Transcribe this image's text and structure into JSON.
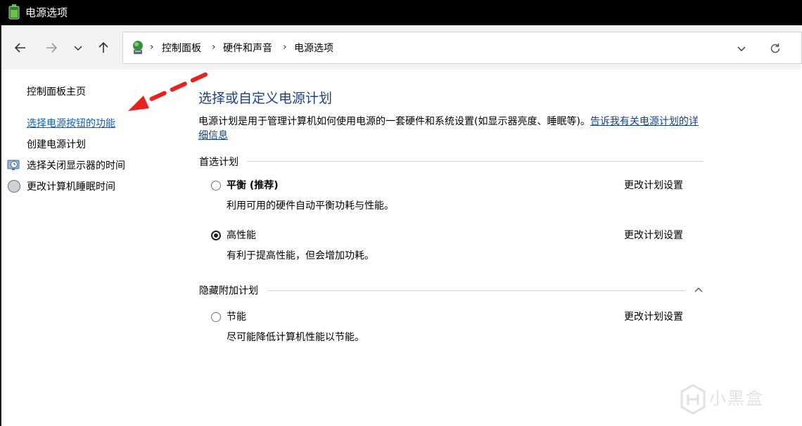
{
  "window": {
    "title": "电源选项"
  },
  "breadcrumb": {
    "items": [
      "控制面板",
      "硬件和声音",
      "电源选项"
    ]
  },
  "sidebar": {
    "home": "控制面板主页",
    "links": [
      {
        "label": "选择电源按钮的功能",
        "highlighted": true
      },
      {
        "label": "创建电源计划",
        "highlighted": false
      },
      {
        "label": "选择关闭显示器的时间",
        "icon": "monitor-clock-icon"
      },
      {
        "label": "更改计算机睡眠时间",
        "icon": "moon-icon"
      }
    ]
  },
  "main": {
    "title": "选择或自定义电源计划",
    "description": "电源计划是用于管理计算机如何使用电源的一套硬件和系统设置(如显示器亮度、睡眠等)。",
    "description_link": "告诉我有关电源计划的详细信息",
    "preferred_group": "首选计划",
    "hidden_group": "隐藏附加计划",
    "plans": [
      {
        "name": "平衡 (推荐)",
        "desc": "利用可用的硬件自动平衡功耗与性能。",
        "link": "更改计划设置",
        "selected": false
      },
      {
        "name": "高性能",
        "desc": "有利于提高性能，但会增加功耗。",
        "link": "更改计划设置",
        "selected": true
      },
      {
        "name": "节能",
        "desc": "尽可能降低计算机性能以节能。",
        "link": "更改计划设置",
        "selected": false
      }
    ]
  },
  "watermark": {
    "text": "小黑盒"
  },
  "colors": {
    "link_blue": "#0b5dd7",
    "title_blue": "#1e3f8a",
    "annotation_red": "#e8231f"
  }
}
